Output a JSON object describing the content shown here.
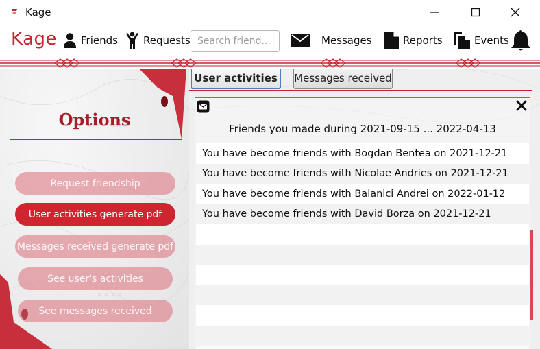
{
  "window": {
    "title": "Kage"
  },
  "toolbar": {
    "brand": "Kage",
    "friends_label": "Friends",
    "requests_label": "Requests",
    "search_placeholder": "Search friend...",
    "messages_label": "Messages",
    "reports_label": "Reports",
    "events_label": "Events"
  },
  "options": {
    "title": "Options",
    "buttons": [
      {
        "label": "Request friendship",
        "state": "faded"
      },
      {
        "label": "User activities generate pdf",
        "state": "active"
      },
      {
        "label": "Messages received generate pdf",
        "state": "faded"
      },
      {
        "label": "See user's activities",
        "state": "faded"
      },
      {
        "label": "See messages received",
        "state": "faded"
      }
    ]
  },
  "tabs": [
    {
      "label": "User activities",
      "selected": true
    },
    {
      "label": "Messages received",
      "selected": false
    }
  ],
  "report": {
    "title": "Friends you made during 2021-09-15 ... 2022-04-13",
    "rows": [
      "You have become friends with Bogdan Bentea on 2021-12-21",
      "You have become friends with Nicolae Andries on 2021-12-21",
      "You have become friends with Balanici Andrei on 2022-01-12",
      "You have become friends with David Borza on 2021-12-21"
    ],
    "empty_rows": 6
  },
  "colors": {
    "accent": "#c8242f",
    "accent_faded": "#dc6e78",
    "tab_focus": "#4a7fc0"
  },
  "icons": {
    "app": "kage-logo-icon",
    "minimize": "minimize-icon",
    "maximize": "maximize-icon",
    "close": "close-icon",
    "friends": "user-icon",
    "requests": "person-arms-up-icon",
    "messages": "envelope-icon",
    "reports": "document-icon",
    "events": "copy-document-icon",
    "notifications": "bell-icon",
    "card_mail": "envelope-icon",
    "card_close": "close-x-icon"
  }
}
